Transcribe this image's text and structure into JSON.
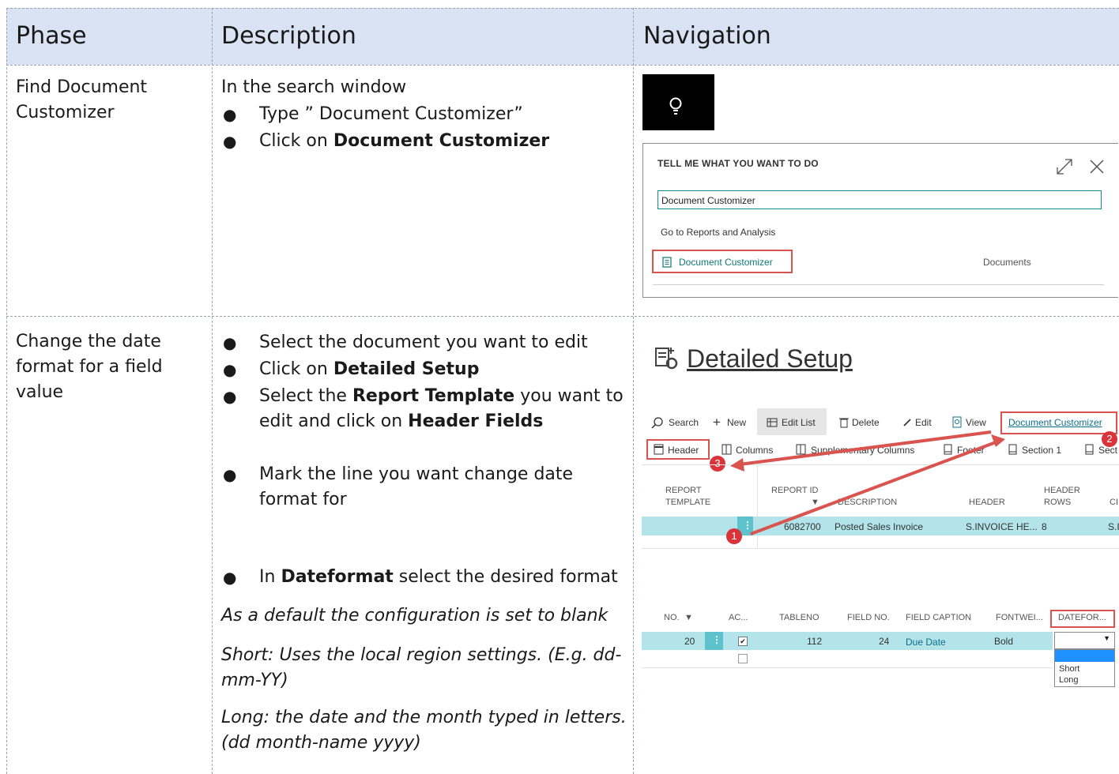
{
  "table": {
    "headers": {
      "phase": "Phase",
      "description": "Description",
      "navigation": "Navigation"
    },
    "row1": {
      "phase": [
        "Find Document",
        "Customizer"
      ],
      "intro": "In the search window",
      "bullet1": "Type ” Document Customizer”",
      "bullet2_pre": "Click on ",
      "bullet2_bold": "Document Customizer"
    },
    "row2": {
      "phase": [
        "Change the date",
        "format for a field",
        "value"
      ],
      "b1": "Select the document you want to edit",
      "b2_pre": "Click on ",
      "b2_bold": "Detailed Setup",
      "b3_pre": "Select the ",
      "b3_bold": "Report Template",
      "b3_post": " you want to",
      "b3_line2_pre": "edit and click on ",
      "b3_line2_bold": "Header Fields",
      "b4_line1": "Mark the line you want change date",
      "b4_line2": "format for",
      "b5_pre": "In ",
      "b5_bold": "Dateformat",
      "b5_post": " select the desired format",
      "i1": "As a default the configuration is set to blank",
      "i2_l1": "Short: Uses the local region settings. (E.g. dd-",
      "i2_l2": "mm-YY)",
      "i3_l1": "Long: the date and the month typed in letters.",
      "i3_l2": "(dd month-name yyyy)"
    }
  },
  "tellme": {
    "title": "TELL ME WHAT YOU WANT TO DO",
    "input_value": "Document Customizer",
    "group": "Go to Reports and Analysis",
    "result": "Document Customizer",
    "category": "Documents"
  },
  "detailed_setup": {
    "title": "Detailed Setup",
    "actions": [
      "Search",
      "New",
      "Edit List",
      "Delete",
      "Edit",
      "View",
      "Document Customizer"
    ],
    "actions2": [
      "Header",
      "Columns",
      "Supplementary Columns",
      "Footer",
      "Section 1",
      "Sect"
    ],
    "badges": [
      "1",
      "2",
      "3"
    ],
    "grid1_headers": [
      "REPORT",
      "TEMPLATE",
      "REPORT ID",
      "DESCRIPTION",
      "HEADER",
      "HEADER",
      "ROWS",
      "CI"
    ],
    "grid1_row": [
      "6082700",
      "Posted Sales Invoice",
      "S.INVOICE HE...",
      "8",
      "S.I"
    ],
    "grid2_headers": [
      "NO.",
      "AC...",
      "TABLENO",
      "FIELD NO.",
      "FIELD CAPTION",
      "FONTWEI...",
      "DATEFOR..."
    ],
    "grid2_row": [
      "20",
      "112",
      "24",
      "Due Date",
      "Bold"
    ],
    "dropdown_options": [
      "Short",
      "Long"
    ]
  },
  "colors": {
    "header_bg": "#dae3f3",
    "highlight_red": "#d9534f",
    "teal_row": "#b2e4ea",
    "link_teal": "#0f7777"
  }
}
